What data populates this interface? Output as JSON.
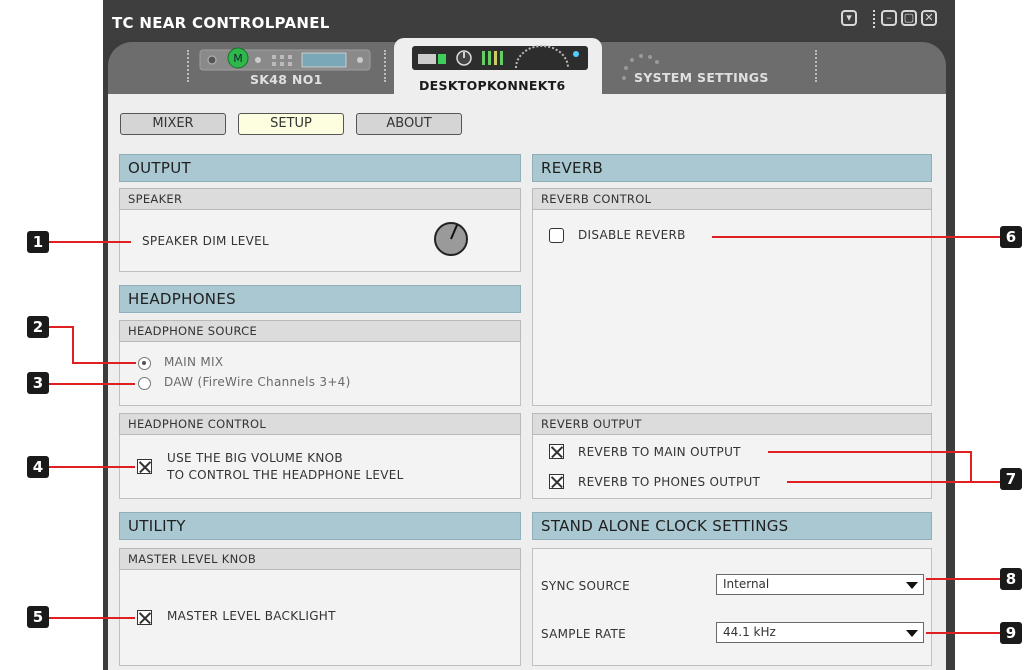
{
  "app": {
    "title": "TC NEAR CONTROLPANEL"
  },
  "window_buttons": [
    {
      "name": "dropdown",
      "glyph": "▾"
    },
    {
      "name": "minimize",
      "glyph": "–"
    },
    {
      "name": "maximize",
      "glyph": "▢"
    },
    {
      "name": "close",
      "glyph": "✕"
    }
  ],
  "device_tabs": [
    {
      "label": "SK48 NO1",
      "active": false
    },
    {
      "label": "DESKTOPKONNEKT6",
      "active": true
    },
    {
      "label": "SYSTEM SETTINGS",
      "active": false
    }
  ],
  "top_buttons": [
    {
      "label": "MIXER",
      "active": false
    },
    {
      "label": "SETUP",
      "active": true
    },
    {
      "label": "ABOUT",
      "active": false
    }
  ],
  "output": {
    "title": "OUTPUT",
    "speaker": {
      "header": "SPEAKER",
      "dim_label": "SPEAKER DIM LEVEL"
    }
  },
  "headphones": {
    "title": "HEADPHONES",
    "source": {
      "header": "HEADPHONE SOURCE",
      "options": [
        {
          "label": "MAIN MIX",
          "selected": true
        },
        {
          "label": "DAW (FireWire Channels 3+4)",
          "selected": false
        }
      ]
    },
    "control": {
      "header": "HEADPHONE CONTROL",
      "checkbox_line1": "USE THE BIG VOLUME KNOB",
      "checkbox_line2": "TO CONTROL THE HEADPHONE LEVEL",
      "checked": true
    }
  },
  "utility": {
    "title": "UTILITY",
    "master": {
      "header": "MASTER LEVEL KNOB",
      "backlight_label": "MASTER LEVEL BACKLIGHT",
      "checked": true
    }
  },
  "reverb": {
    "title": "REVERB",
    "control": {
      "header": "REVERB CONTROL",
      "disable_label": "DISABLE REVERB",
      "checked": false
    },
    "output": {
      "header": "REVERB OUTPUT",
      "to_main_label": "REVERB TO MAIN OUTPUT",
      "to_phones_label": "REVERB TO PHONES OUTPUT",
      "to_main_checked": true,
      "to_phones_checked": true
    }
  },
  "clock": {
    "title": "STAND ALONE CLOCK SETTINGS",
    "sync_source_label": "SYNC SOURCE",
    "sync_source_value": "Internal",
    "sample_rate_label": "SAMPLE RATE",
    "sample_rate_value": "44.1 kHz"
  },
  "callouts": [
    "1",
    "2",
    "3",
    "4",
    "5",
    "6",
    "7",
    "8",
    "9"
  ],
  "colors": {
    "section_header": "#a9c8d1",
    "callout_line": "#e02020",
    "active_button": "#fdfde0"
  }
}
